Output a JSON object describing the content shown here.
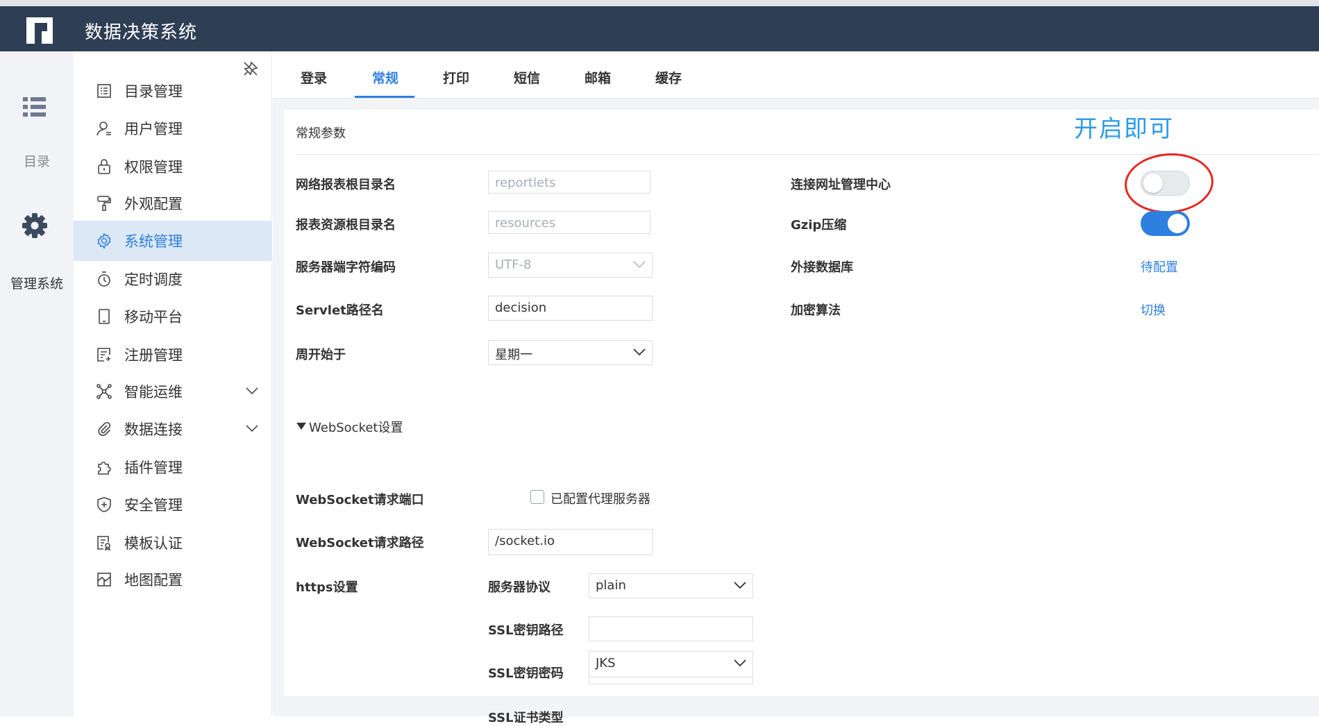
{
  "app": {
    "title": "数据决策系统"
  },
  "rail": {
    "catalog_label": "目录",
    "admin_label": "管理系统"
  },
  "sidebar": {
    "items": [
      {
        "label": "目录管理",
        "icon": "list-doc-icon"
      },
      {
        "label": "用户管理",
        "icon": "user-icon"
      },
      {
        "label": "权限管理",
        "icon": "lock-icon"
      },
      {
        "label": "外观配置",
        "icon": "paint-roller-icon"
      },
      {
        "label": "系统管理",
        "icon": "gear-icon",
        "active": true
      },
      {
        "label": "定时调度",
        "icon": "stopwatch-icon"
      },
      {
        "label": "移动平台",
        "icon": "tablet-icon"
      },
      {
        "label": "注册管理",
        "icon": "register-icon"
      },
      {
        "label": "智能运维",
        "icon": "network-icon",
        "expandable": true
      },
      {
        "label": "数据连接",
        "icon": "paperclip-icon",
        "expandable": true
      },
      {
        "label": "插件管理",
        "icon": "puzzle-icon"
      },
      {
        "label": "安全管理",
        "icon": "shield-icon"
      },
      {
        "label": "模板认证",
        "icon": "template-icon"
      },
      {
        "label": "地图配置",
        "icon": "map-icon"
      }
    ]
  },
  "tabs": [
    "登录",
    "常规",
    "打印",
    "短信",
    "邮箱",
    "缓存"
  ],
  "active_tab": "常规",
  "panel": {
    "title": "常规参数",
    "annotation": "开启即可",
    "fields": {
      "report_root_label": "网络报表根目录名",
      "report_root_value": "reportlets",
      "resource_root_label": "报表资源根目录名",
      "resource_root_value": "resources",
      "charset_label": "服务器端字符编码",
      "charset_value": "UTF-8",
      "servlet_label": "Servlet路径名",
      "servlet_value": "decision",
      "week_start_label": "周开始于",
      "week_start_value": "星期一",
      "websocket_section": "WebSocket设置",
      "ws_port_label": "WebSocket请求端口",
      "proxy_label": "已配置代理服务器",
      "proxy_checked": false,
      "ws_path_label": "WebSocket请求路径",
      "ws_path_value": "/socket.io",
      "https_label": "https设置",
      "protocol_label": "服务器协议",
      "protocol_value": "plain",
      "ssl_path_label": "SSL密钥路径",
      "ssl_path_value": "",
      "ssl_pwd_label": "SSL密钥密码",
      "ssl_pwd_value": "••••••••",
      "ssl_type_label": "SSL证书类型",
      "ssl_type_value": "JKS"
    },
    "right": {
      "connect_center_label": "连接网址管理中心",
      "connect_center_on": false,
      "gzip_label": "Gzip压缩",
      "gzip_on": true,
      "ext_db_label": "外接数据库",
      "ext_db_link": "待配置",
      "encrypt_label": "加密算法",
      "encrypt_link": "切换"
    }
  },
  "colors": {
    "accent": "#2d7fe0",
    "header": "#2e3e55",
    "annotation": "#2d9be6",
    "highlight_circle": "#e5261f"
  }
}
